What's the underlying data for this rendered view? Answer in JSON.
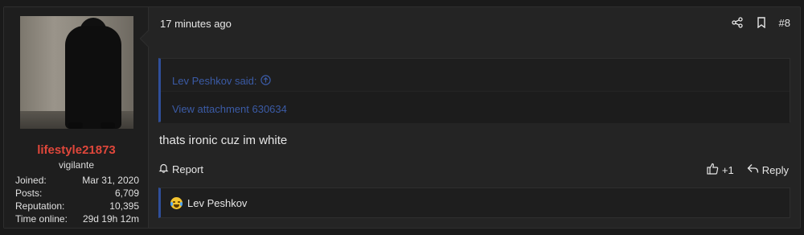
{
  "user": {
    "username": "lifestyle21873",
    "title": "vigilante",
    "stats": [
      {
        "label": "Joined:",
        "value": "Mar 31, 2020"
      },
      {
        "label": "Posts:",
        "value": "6,709"
      },
      {
        "label": "Reputation:",
        "value": "10,395"
      },
      {
        "label": "Time online:",
        "value": "29d 19h 12m"
      }
    ]
  },
  "post": {
    "timestamp": "17 minutes ago",
    "number": "#8",
    "quote": {
      "author_line": "Lev Peshkov said:",
      "body": "View attachment 630634"
    },
    "message": "thats ironic cuz im white",
    "report_label": "Report",
    "like_label": "+1",
    "reply_label": "Reply",
    "reaction_user": "Lev Peshkov"
  },
  "colors": {
    "username": "#e0473b",
    "quote_link": "#3b5ba6",
    "quote_border": "#2f4f9a"
  },
  "icons": [
    "share-icon",
    "bookmark-icon",
    "arrow-up-circle-icon",
    "bell-icon",
    "thumbs-up-icon",
    "reply-icon",
    "laughing-emoji-icon"
  ]
}
